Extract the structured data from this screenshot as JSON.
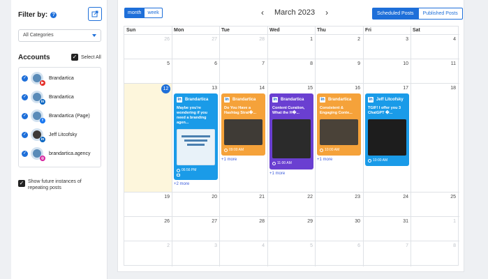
{
  "sidebar": {
    "filter_title": "Filter by:",
    "help_icon": "question-circle-icon",
    "export_icon": "export-icon",
    "category_select": "All Categories",
    "accounts_title": "Accounts",
    "select_all": "Select All",
    "accounts": [
      {
        "name": "Brandartica",
        "network": "youtube"
      },
      {
        "name": "Brandartica",
        "network": "linkedin"
      },
      {
        "name": "Brandartica (Page)",
        "network": "facebook"
      },
      {
        "name": "Jeff Litcofsky",
        "network": "linkedin"
      },
      {
        "name": "brandartica.agency",
        "network": "instagram"
      }
    ],
    "future_instances": "Show future instances of repeating posts"
  },
  "toolbar": {
    "view_month": "month",
    "view_week": "week",
    "prev_icon": "chevron-left-icon",
    "month_label": "March 2023",
    "next_icon": "chevron-right-icon",
    "scheduled": "Scheduled Posts",
    "published": "Published Posts"
  },
  "calendar": {
    "weekdays": [
      "Sun",
      "Mon",
      "Tue",
      "Wed",
      "Thu",
      "Fri",
      "Sat"
    ],
    "weeks": [
      [
        "26",
        "27",
        "28",
        "1",
        "2",
        "3",
        "4"
      ],
      [
        "5",
        "6",
        "7",
        "8",
        "9",
        "10",
        "11"
      ],
      [
        "12",
        "13",
        "14",
        "15",
        "16",
        "17",
        "18"
      ],
      [
        "19",
        "20",
        "21",
        "22",
        "23",
        "24",
        "25"
      ],
      [
        "26",
        "27",
        "28",
        "29",
        "30",
        "31",
        "1"
      ],
      [
        "2",
        "3",
        "4",
        "5",
        "6",
        "7",
        "8"
      ]
    ],
    "posts": [
      {
        "account": "Brandartica",
        "text": "Maybe you're wondering if you need a branding agen...",
        "time": "06:56 PM",
        "more": "+2 more",
        "color": "#1a9be8"
      },
      {
        "account": "Brandartica",
        "text": "Do You Have a Hashtag Strat�...",
        "time": "09:00 AM",
        "more": "+1 more",
        "color": "#f5a23a"
      },
      {
        "account": "Brandartica",
        "text": "Content Curation, What the H�...",
        "time": "11:00 AM",
        "more": "+1 more",
        "color": "#6a3fd1"
      },
      {
        "account": "Brandartica",
        "text": "Consistent & Engaging Conte...",
        "time": "10:00 AM",
        "more": "+1 more",
        "color": "#f5a23a"
      },
      {
        "account": "Jeff Litcofsky",
        "text": "TGIF! I offer you 3 ChatGPT �...",
        "time": "10:00 AM",
        "more": "",
        "color": "#1a9be8"
      }
    ]
  }
}
